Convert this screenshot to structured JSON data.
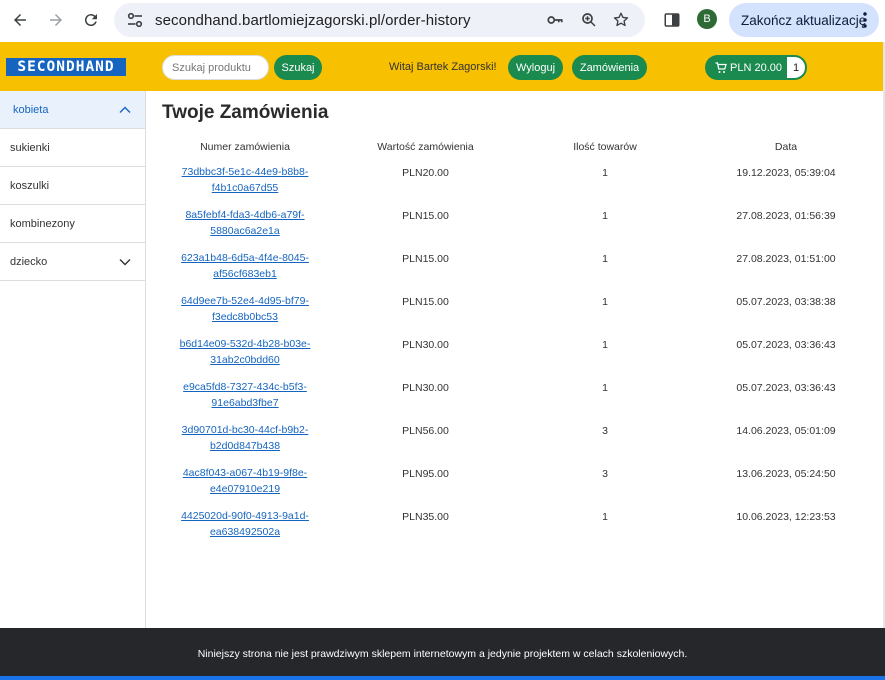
{
  "browser": {
    "url": "secondhand.bartlomiejzagorski.pl/order-history",
    "profile_initial": "B",
    "update_label": "Zakończ aktualizację"
  },
  "header": {
    "logo": "SECONDHAND",
    "search_placeholder": "Szukaj produktu",
    "search_button": "Szukaj",
    "greeting": "Witaj Bartek Zagorski!",
    "logout_button": "Wyloguj",
    "orders_button": "Zamówienia",
    "cart_total": "PLN 20.00",
    "cart_count": "1"
  },
  "sidebar": {
    "items": [
      {
        "label": "kobieta",
        "icon": "chevron-up-icon"
      },
      {
        "label": "sukienki"
      },
      {
        "label": "koszulki"
      },
      {
        "label": "kombinezony"
      },
      {
        "label": "dziecko",
        "icon": "chevron-down-icon"
      }
    ]
  },
  "main": {
    "title": "Twoje Zamówienia",
    "columns": [
      "Numer zamówienia",
      "Wartość zamówienia",
      "Ilość towarów",
      "Data"
    ],
    "orders": [
      {
        "id1": "73dbbc3f-5e1c-44e9-b8b8-",
        "id2": "f4b1c0a67d55",
        "value": "PLN20.00",
        "qty": "1",
        "date": "19.12.2023, 05:39:04"
      },
      {
        "id1": "8a5febf4-fda3-4db6-a79f-",
        "id2": "5880ac6a2e1a",
        "value": "PLN15.00",
        "qty": "1",
        "date": "27.08.2023, 01:56:39"
      },
      {
        "id1": "623a1b48-6d5a-4f4e-8045-",
        "id2": "af56cf683eb1",
        "value": "PLN15.00",
        "qty": "1",
        "date": "27.08.2023, 01:51:00"
      },
      {
        "id1": "64d9ee7b-52e4-4d95-bf79-",
        "id2": "f3edc8b0bc53",
        "value": "PLN15.00",
        "qty": "1",
        "date": "05.07.2023, 03:38:38"
      },
      {
        "id1": "b6d14e09-532d-4b28-b03e-",
        "id2": "31ab2c0bdd60",
        "value": "PLN30.00",
        "qty": "1",
        "date": "05.07.2023, 03:36:43"
      },
      {
        "id1": "e9ca5fd8-7327-434c-b5f3-",
        "id2": "91e6abd3fbe7",
        "value": "PLN30.00",
        "qty": "1",
        "date": "05.07.2023, 03:36:43"
      },
      {
        "id1": "3d90701d-bc30-44cf-b9b2-",
        "id2": "b2d0d847b438",
        "value": "PLN56.00",
        "qty": "3",
        "date": "14.06.2023, 05:01:09"
      },
      {
        "id1": "4ac8f043-a067-4b19-9f8e-",
        "id2": "e4e07910e219",
        "value": "PLN95.00",
        "qty": "3",
        "date": "13.06.2023, 05:24:50"
      },
      {
        "id1": "4425020d-90f0-4913-9a1d-",
        "id2": "ea638492502a",
        "value": "PLN35.00",
        "qty": "1",
        "date": "10.06.2023, 12:23:53"
      }
    ]
  },
  "footer": {
    "text": "Niniejszy strona nie jest prawdziwym sklepem internetowym a jedynie projektem w celach szkoleniowych."
  }
}
